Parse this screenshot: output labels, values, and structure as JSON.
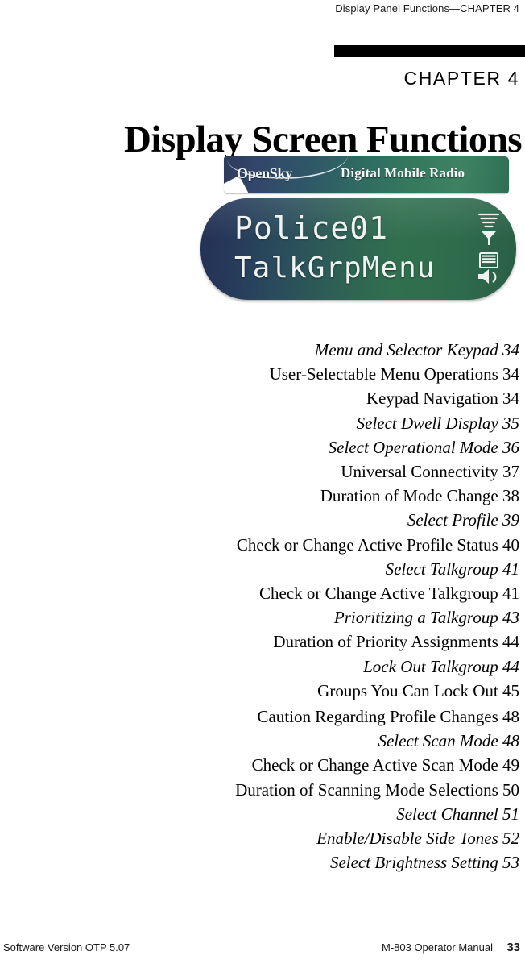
{
  "header": {
    "running_head": "Display Panel Functions—CHAPTER 4"
  },
  "chapter": {
    "number_label": "CHAPTER 4",
    "title": "Display Screen Functions"
  },
  "figure": {
    "name": "radio-display-screen",
    "banner": {
      "brand": "OpenSky",
      "tagline": "Digital Mobile Radio",
      "gradient_start": "#2d3a5c",
      "gradient_end": "#3d8361"
    },
    "lcd": {
      "line1": "Police01",
      "line2": "TalkGrpMenu",
      "text_color": "#eef3f2",
      "gradient_start": "#243154",
      "gradient_end": "#31704f",
      "icons": [
        "signal-strength-icon",
        "battery-speaker-icon"
      ]
    }
  },
  "toc": {
    "entries": [
      {
        "label": "Menu and Selector Keypad 34",
        "style": "italic",
        "page": 34
      },
      {
        "label": "User-Selectable Menu Operations 34",
        "style": "roman",
        "page": 34
      },
      {
        "label": "Keypad Navigation 34",
        "style": "roman",
        "page": 34
      },
      {
        "label": "Select Dwell Display 35",
        "style": "italic",
        "page": 35
      },
      {
        "label": "Select Operational Mode 36",
        "style": "italic",
        "page": 36
      },
      {
        "label": "Universal Connectivity 37",
        "style": "roman",
        "page": 37
      },
      {
        "label": "Duration of Mode Change 38",
        "style": "roman",
        "page": 38
      },
      {
        "label": "Select Profile 39",
        "style": "italic",
        "page": 39
      },
      {
        "label": "Check or Change Active Profile Status 40",
        "style": "roman",
        "page": 40
      },
      {
        "label": "Select Talkgroup 41",
        "style": "italic",
        "page": 41
      },
      {
        "label": "Check or Change Active Talkgroup 41",
        "style": "roman",
        "page": 41
      },
      {
        "label": "Prioritizing a Talkgroup 43",
        "style": "italic",
        "page": 43
      },
      {
        "label": "Duration of Priority Assignments 44",
        "style": "roman",
        "page": 44
      },
      {
        "label": "Lock Out Talkgroup 44",
        "style": "italic",
        "page": 44
      },
      {
        "label": "Groups You Can Lock Out 45",
        "style": "roman",
        "page": 45
      },
      {
        "label": "Caution Regarding Profile Changes 48",
        "style": "roman",
        "page": 48,
        "gap_before": true
      },
      {
        "label": "Select Scan Mode 48",
        "style": "italic",
        "page": 48
      },
      {
        "label": "Check or Change Active Scan Mode 49",
        "style": "roman",
        "page": 49
      },
      {
        "label": "Duration of Scanning Mode Selections 50",
        "style": "roman",
        "page": 50
      },
      {
        "label": "Select Channel 51",
        "style": "italic",
        "page": 51
      },
      {
        "label": "Enable/Disable Side Tones 52",
        "style": "italic",
        "page": 52
      },
      {
        "label": "Select Brightness Setting 53",
        "style": "italic",
        "page": 53
      }
    ]
  },
  "footer": {
    "left": "Software Version OTP 5.07",
    "manual": "M-803 Operator Manual",
    "page_number": "33"
  }
}
